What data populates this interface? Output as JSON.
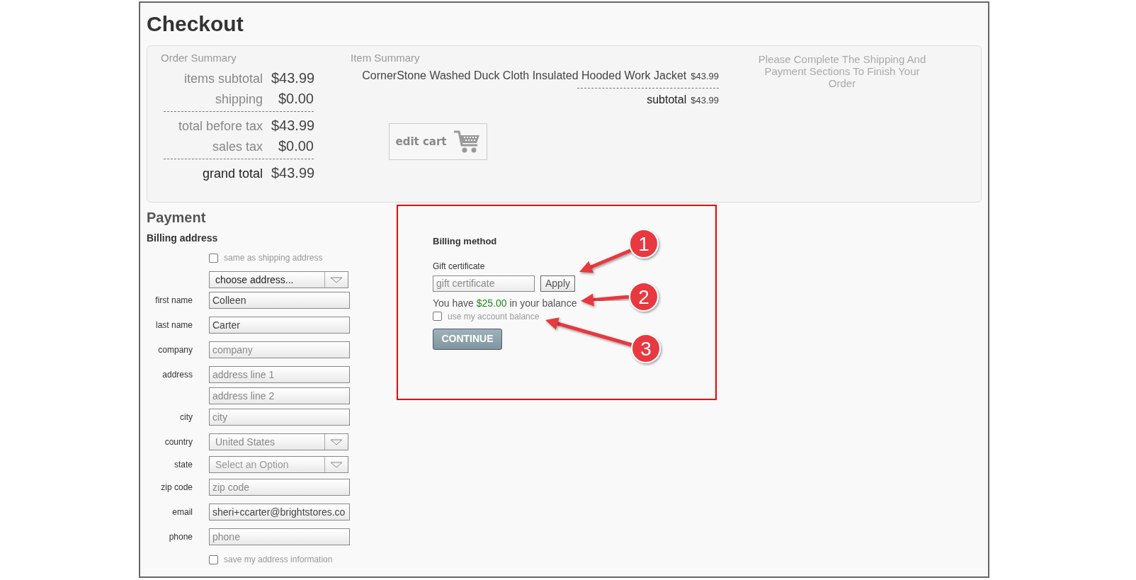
{
  "title": "Checkout",
  "order_summary": {
    "heading": "Order Summary",
    "groups": [
      [
        {
          "label": "items subtotal",
          "value": "$43.99",
          "kind": "line"
        },
        {
          "label": "shipping",
          "value": "$0.00",
          "kind": "line"
        }
      ],
      [
        {
          "label": "total before tax",
          "value": "$43.99",
          "kind": "line"
        },
        {
          "label": "sales tax",
          "value": "$0.00",
          "kind": "line"
        }
      ],
      [
        {
          "label": "grand total",
          "value": "$43.99",
          "kind": "total"
        }
      ]
    ]
  },
  "item_summary": {
    "heading": "Item Summary",
    "items": [
      {
        "name": "CornerStone Washed Duck Cloth Insulated Hooded Work Jacket",
        "price": "$43.99"
      }
    ],
    "subtotal_label": "subtotal",
    "subtotal_value": "$43.99",
    "edit_cart_button": "edit cart"
  },
  "notice": "Please Complete The Shipping And Payment Sections To Finish Your Order",
  "payment": {
    "heading": "Payment",
    "billing_address": {
      "heading": "Billing address",
      "same_as_shipping": {
        "label": "same as shipping address",
        "checked": false
      },
      "address_select": {
        "value": "choose address..."
      },
      "fields": [
        {
          "kind": "input",
          "label": "first name",
          "value": "Colleen"
        },
        {
          "kind": "input",
          "label": "last name",
          "value": "Carter"
        },
        {
          "kind": "input",
          "label": "company",
          "placeholder": "company"
        },
        {
          "kind": "input",
          "label": "address",
          "placeholder": "address line 1"
        },
        {
          "kind": "input",
          "placeholder": "address line 2"
        },
        {
          "kind": "input",
          "label": "city",
          "placeholder": "city"
        },
        {
          "kind": "select",
          "label": "country",
          "value": "United States"
        },
        {
          "kind": "select",
          "label": "state",
          "placeholder": "Select an Option"
        },
        {
          "kind": "input",
          "label": "zip code",
          "placeholder": "zip code"
        },
        {
          "kind": "input",
          "label": "email",
          "value": "sheri+ccarter@brightstores.co"
        },
        {
          "kind": "input",
          "label": "phone",
          "placeholder": "phone"
        }
      ],
      "save_address": {
        "label": "save my address information",
        "checked": false
      }
    },
    "billing_method": {
      "heading": "Billing method",
      "gift_label": "Gift certificate",
      "gift_placeholder": "gift certificate",
      "apply_button": "Apply",
      "balance": {
        "before": "You have ",
        "amount": "$25.00",
        "after": " in your balance"
      },
      "use_balance": {
        "label": "use my account balance",
        "checked": false
      },
      "continue_button": "CONTINUE"
    }
  },
  "annotations": [
    {
      "kind": "highlight"
    },
    {
      "kind": "callout",
      "label": "1"
    },
    {
      "kind": "callout",
      "label": "2"
    },
    {
      "kind": "callout",
      "label": "3"
    }
  ]
}
